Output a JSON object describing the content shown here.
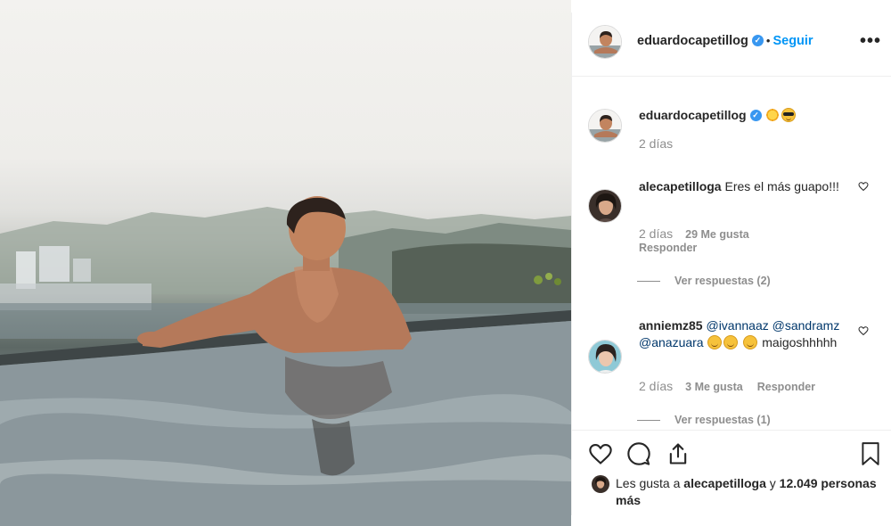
{
  "post": {
    "author": "eduardocapetillog",
    "follow_label": "Seguir",
    "separator": "•",
    "more_label": "•••"
  },
  "caption": {
    "username": "eduardocapetillog",
    "emojis": [
      "sun",
      "smiling-face-with-sunglasses"
    ],
    "time": "2 días"
  },
  "comments": [
    {
      "username": "alecapetilloga",
      "text": "Eres el más guapo!!!",
      "time": "2 días",
      "likes": "29 Me gusta",
      "reply_label": "Responder",
      "view_replies": "Ver respuestas (2)"
    },
    {
      "username": "anniemz85",
      "mentions": [
        "@ivannaaz",
        "@sandramz",
        "@anazuara"
      ],
      "text": "maigoshhhhh",
      "time": "2 días",
      "likes": "3 Me gusta",
      "reply_label": "Responder",
      "view_replies": "Ver respuestas (1)"
    }
  ],
  "liked_by": {
    "prefix": "Les gusta a",
    "user": "alecapetilloga",
    "joiner": "y",
    "others": "12.049 personas más"
  },
  "colors": {
    "link_blue": "#0095f6",
    "verified_blue": "#3897f0",
    "secondary_text": "#8e8e8e",
    "mention": "#00376b"
  },
  "icons": [
    "heart-icon",
    "comment-icon",
    "share-icon",
    "bookmark-icon",
    "verified-icon",
    "more-options-icon",
    "sun-emoji-icon",
    "sunglasses-emoji-icon"
  ]
}
